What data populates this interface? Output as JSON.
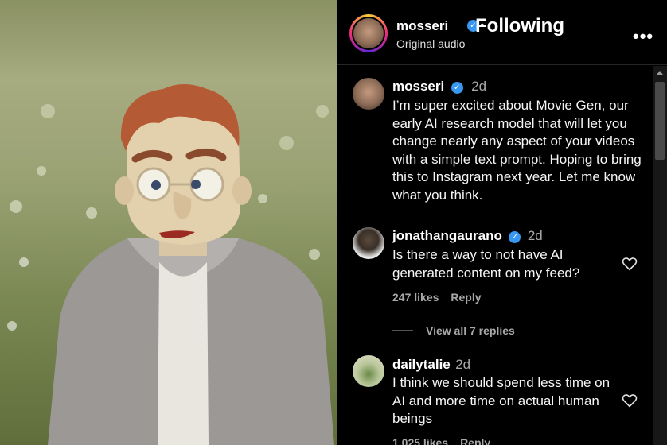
{
  "post": {
    "author": "mosseri",
    "follow_state": "Following",
    "audio": "Original audio",
    "separator": "•"
  },
  "comments": [
    {
      "user": "mosseri",
      "verified": true,
      "age": "2d",
      "text": "I’m super excited about Movie Gen, our early AI research model that will let you change nearly any aspect of your videos with a simple text prompt. Hoping to bring this to Instagram next year. Let me know what you think."
    },
    {
      "user": "jonathangaurano",
      "verified": true,
      "age": "2d",
      "text": "Is there a way to not have AI generated content on my feed?",
      "likes": "247 likes",
      "reply": "Reply",
      "view_replies": "View all 7 replies"
    },
    {
      "user": "dailytalie",
      "verified": false,
      "age": "2d",
      "text": "I think we should spend less time on AI and more time on actual human beings",
      "likes": "1,025 likes",
      "reply": "Reply"
    }
  ],
  "icons": {
    "verified": "verified-badge-icon",
    "more": "more-options-icon",
    "heart": "heart-outline-icon"
  },
  "colors": {
    "verified_blue": "#3897f0",
    "story_ring": "#ee2a7b"
  }
}
